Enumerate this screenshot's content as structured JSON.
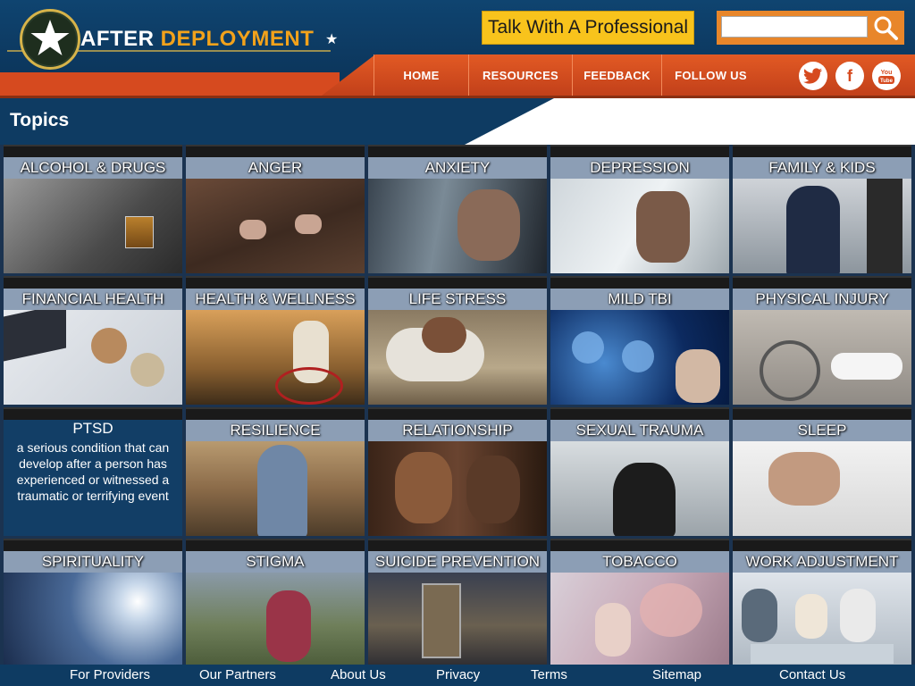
{
  "brand": {
    "word1": "AFTER",
    "word2": "DEPLOYMENT"
  },
  "header": {
    "talk_button": "Talk With A Professional",
    "search_placeholder": "",
    "nav": [
      "HOME",
      "RESOURCES",
      "FEEDBACK",
      "FOLLOW US"
    ],
    "social": [
      "twitter-icon",
      "facebook-icon",
      "youtube-icon"
    ]
  },
  "section_title": "Topics",
  "tiles": [
    {
      "label": "ALCOHOL & DRUGS"
    },
    {
      "label": "ANGER"
    },
    {
      "label": "ANXIETY"
    },
    {
      "label": "DEPRESSION"
    },
    {
      "label": "FAMILY & KIDS"
    },
    {
      "label": "FINANCIAL HEALTH"
    },
    {
      "label": "HEALTH & WELLNESS"
    },
    {
      "label": "LIFE STRESS"
    },
    {
      "label": "MILD TBI"
    },
    {
      "label": "PHYSICAL INJURY"
    },
    {
      "label": "PTSD",
      "description": "a serious condition that can develop after a person has experienced or witnessed a traumatic or terrifying event"
    },
    {
      "label": "RESILIENCE"
    },
    {
      "label": "RELATIONSHIP"
    },
    {
      "label": "SEXUAL TRAUMA"
    },
    {
      "label": "SLEEP"
    },
    {
      "label": "SPIRITUALITY"
    },
    {
      "label": "STIGMA"
    },
    {
      "label": "SUICIDE PREVENTION"
    },
    {
      "label": "TOBACCO"
    },
    {
      "label": "WORK ADJUSTMENT"
    }
  ],
  "footer": [
    "For Providers",
    "Our Partners",
    "About Us",
    "Privacy",
    "Terms",
    "Sitemap",
    "Contact Us"
  ],
  "colors": {
    "nav_orange": "#d64a1f",
    "header_blue": "#0e3b62",
    "talk_yellow": "#f8c31c",
    "accent_gold": "#f2a21b"
  }
}
